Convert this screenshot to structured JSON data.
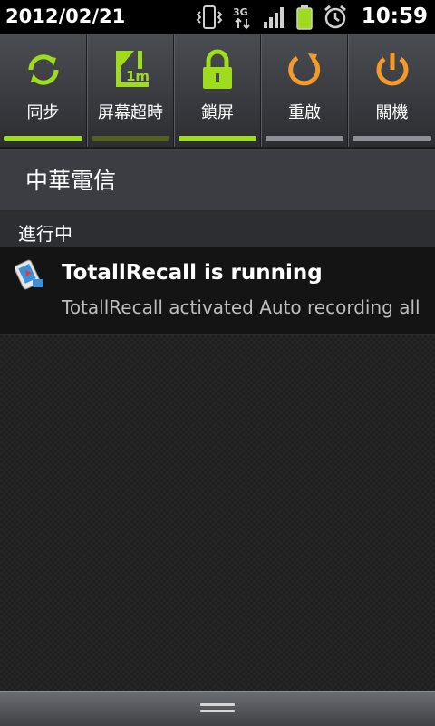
{
  "status_bar": {
    "date": "2012/02/21",
    "time": "10:59",
    "network": "3G",
    "icons": [
      "vibrate-icon",
      "network-3g-icon",
      "signal-icon",
      "battery-icon",
      "alarm-icon"
    ]
  },
  "toggles": [
    {
      "label": "同步",
      "icon": "sync-icon",
      "state": "on"
    },
    {
      "label": "屏幕超時",
      "icon": "screen-timeout-icon",
      "icon_text": "1m",
      "state": "partial"
    },
    {
      "label": "鎖屏",
      "icon": "lock-icon",
      "state": "on"
    },
    {
      "label": "重啟",
      "icon": "restart-icon",
      "state": "off"
    },
    {
      "label": "關機",
      "icon": "power-icon",
      "state": "off"
    }
  ],
  "carrier": {
    "name": "中華電信"
  },
  "ongoing": {
    "label": "進行中"
  },
  "notification": {
    "title": "TotallRecall is running",
    "text": "TotallRecall activated Auto recording all calls",
    "icon": "totalrecall-app-icon"
  },
  "colors": {
    "accent_green": "#9fdc1e",
    "restart_orange": "#f39a2b",
    "status_bar_bg": "#000000"
  }
}
